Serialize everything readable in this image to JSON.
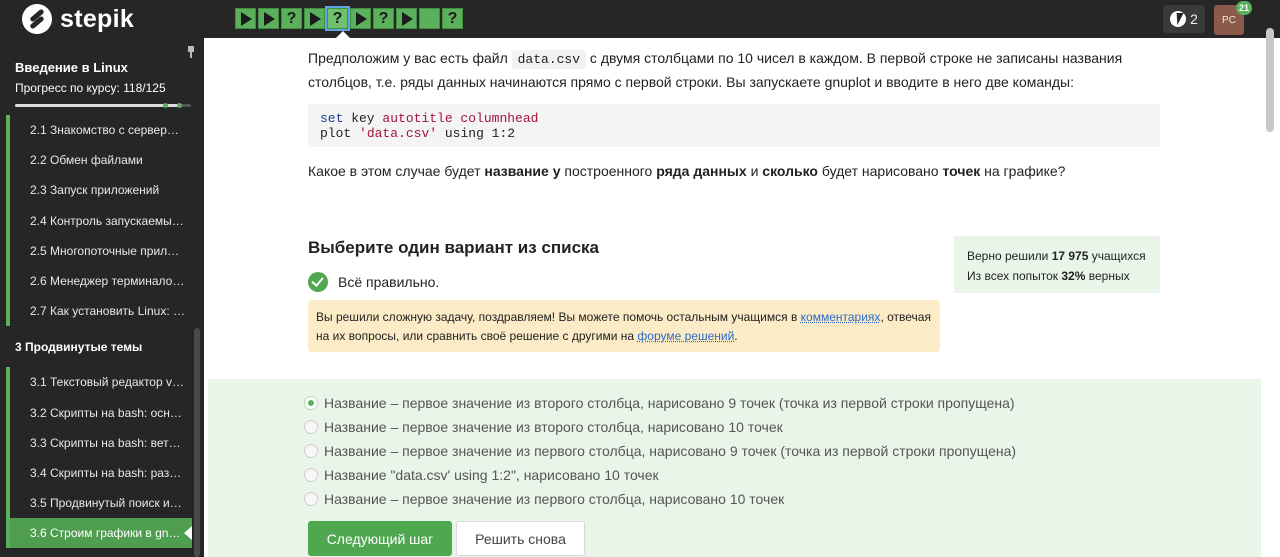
{
  "brand": {
    "logo_text": "stepik"
  },
  "steps": [
    {
      "kind": "video"
    },
    {
      "kind": "video"
    },
    {
      "kind": "question"
    },
    {
      "kind": "video"
    },
    {
      "kind": "question",
      "current": true
    },
    {
      "kind": "video"
    },
    {
      "kind": "question"
    },
    {
      "kind": "video"
    },
    {
      "kind": "blank"
    },
    {
      "kind": "question"
    }
  ],
  "header": {
    "streak_count": "2",
    "avatar_initials": "PC",
    "notifications": "21"
  },
  "sidebar": {
    "course_title": "Введение в Linux",
    "progress_label": "Прогресс по курсу:  118/125",
    "progress_value": 118,
    "progress_total": 125,
    "items": [
      {
        "label": "2.1  Знакомство с сервер…"
      },
      {
        "label": "2.2  Обмен файлами"
      },
      {
        "label": "2.3  Запуск приложений"
      },
      {
        "label": "2.4  Контроль запускаемы…"
      },
      {
        "label": "2.5  Многопоточные прил…"
      },
      {
        "label": "2.6  Менеджер терминало…"
      },
      {
        "label": "2.7  Как установить Linux: …"
      },
      {
        "label": "3  Продвинутые темы",
        "section": true
      },
      {
        "label": "3.1  Текстовый редактор v…"
      },
      {
        "label": "3.2  Скрипты на bash: осн…"
      },
      {
        "label": "3.3  Скрипты на bash: вет…"
      },
      {
        "label": "3.4  Скрипты на bash: раз…"
      },
      {
        "label": "3.5  Продвинутый поиск и…"
      },
      {
        "label": "3.6  Строим графики в gnu…",
        "active": true
      }
    ]
  },
  "question": {
    "intro_before_code": "Предположим у вас есть файл ",
    "inline_code": "data.csv",
    "intro_after_code": " с двумя столбцами по 10 чисел в каждом. В первой строке не записаны названия столбцов, т.е. ряды данных начинаются прямо с первой строки. Вы запускаете gnuplot и вводите в него две команды:",
    "code_line1": {
      "kw": "set",
      "plain": " key ",
      "str": "autotitle columnhead"
    },
    "code_line2": {
      "kw": "plot",
      "plain_before": " ",
      "str": "'data.csv'",
      "plain_mid": " ",
      "kw2": "using",
      "plain_after": " 1:2"
    },
    "prompt_parts": [
      {
        "text": "Какое в этом случае будет ",
        "bold": false
      },
      {
        "text": "название у",
        "bold": true
      },
      {
        "text": " построенного ",
        "bold": false
      },
      {
        "text": "ряда данных",
        "bold": true
      },
      {
        "text": " и ",
        "bold": false
      },
      {
        "text": "сколько",
        "bold": true
      },
      {
        "text": " будет нарисовано ",
        "bold": false
      },
      {
        "text": "точек",
        "bold": true
      },
      {
        "text": " на графике?",
        "bold": false
      }
    ]
  },
  "answer": {
    "heading": "Выберите один вариант из списка",
    "correct_text": "Всё правильно.",
    "congrats_before_link1": "Вы решили сложную задачу, поздравляем! Вы можете помочь остальным учащимся в ",
    "link_comments": "комментариях",
    "congrats_between": ", отвечая на их вопросы, или сравнить своё решение с другими на ",
    "link_forum": "форуме решений",
    "congrats_end": "."
  },
  "stats": {
    "solved_prefix": "Верно решили ",
    "solved_count": "17 975",
    "solved_suffix": " учащихся",
    "attempts_prefix": "Из всех попыток ",
    "attempts_percent": "32%",
    "attempts_suffix": " верных"
  },
  "options": [
    {
      "label": "Название – первое значение из второго столбца, нарисовано 9 точек (точка из первой строки пропущена)",
      "checked": true
    },
    {
      "label": "Название – первое значение из второго столбца, нарисовано 10 точек",
      "checked": false
    },
    {
      "label": "Название – первое значение из первого столбца, нарисовано 9 точек (точка из первой строки пропущена)",
      "checked": false
    },
    {
      "label": "Название \"data.csv' using 1:2\", нарисовано 10 точек",
      "checked": false
    },
    {
      "label": "Название – первое значение из первого столбца, нарисовано 10 точек",
      "checked": false
    }
  ],
  "buttons": {
    "next": "Следующий шаг",
    "retry": "Решить снова"
  }
}
